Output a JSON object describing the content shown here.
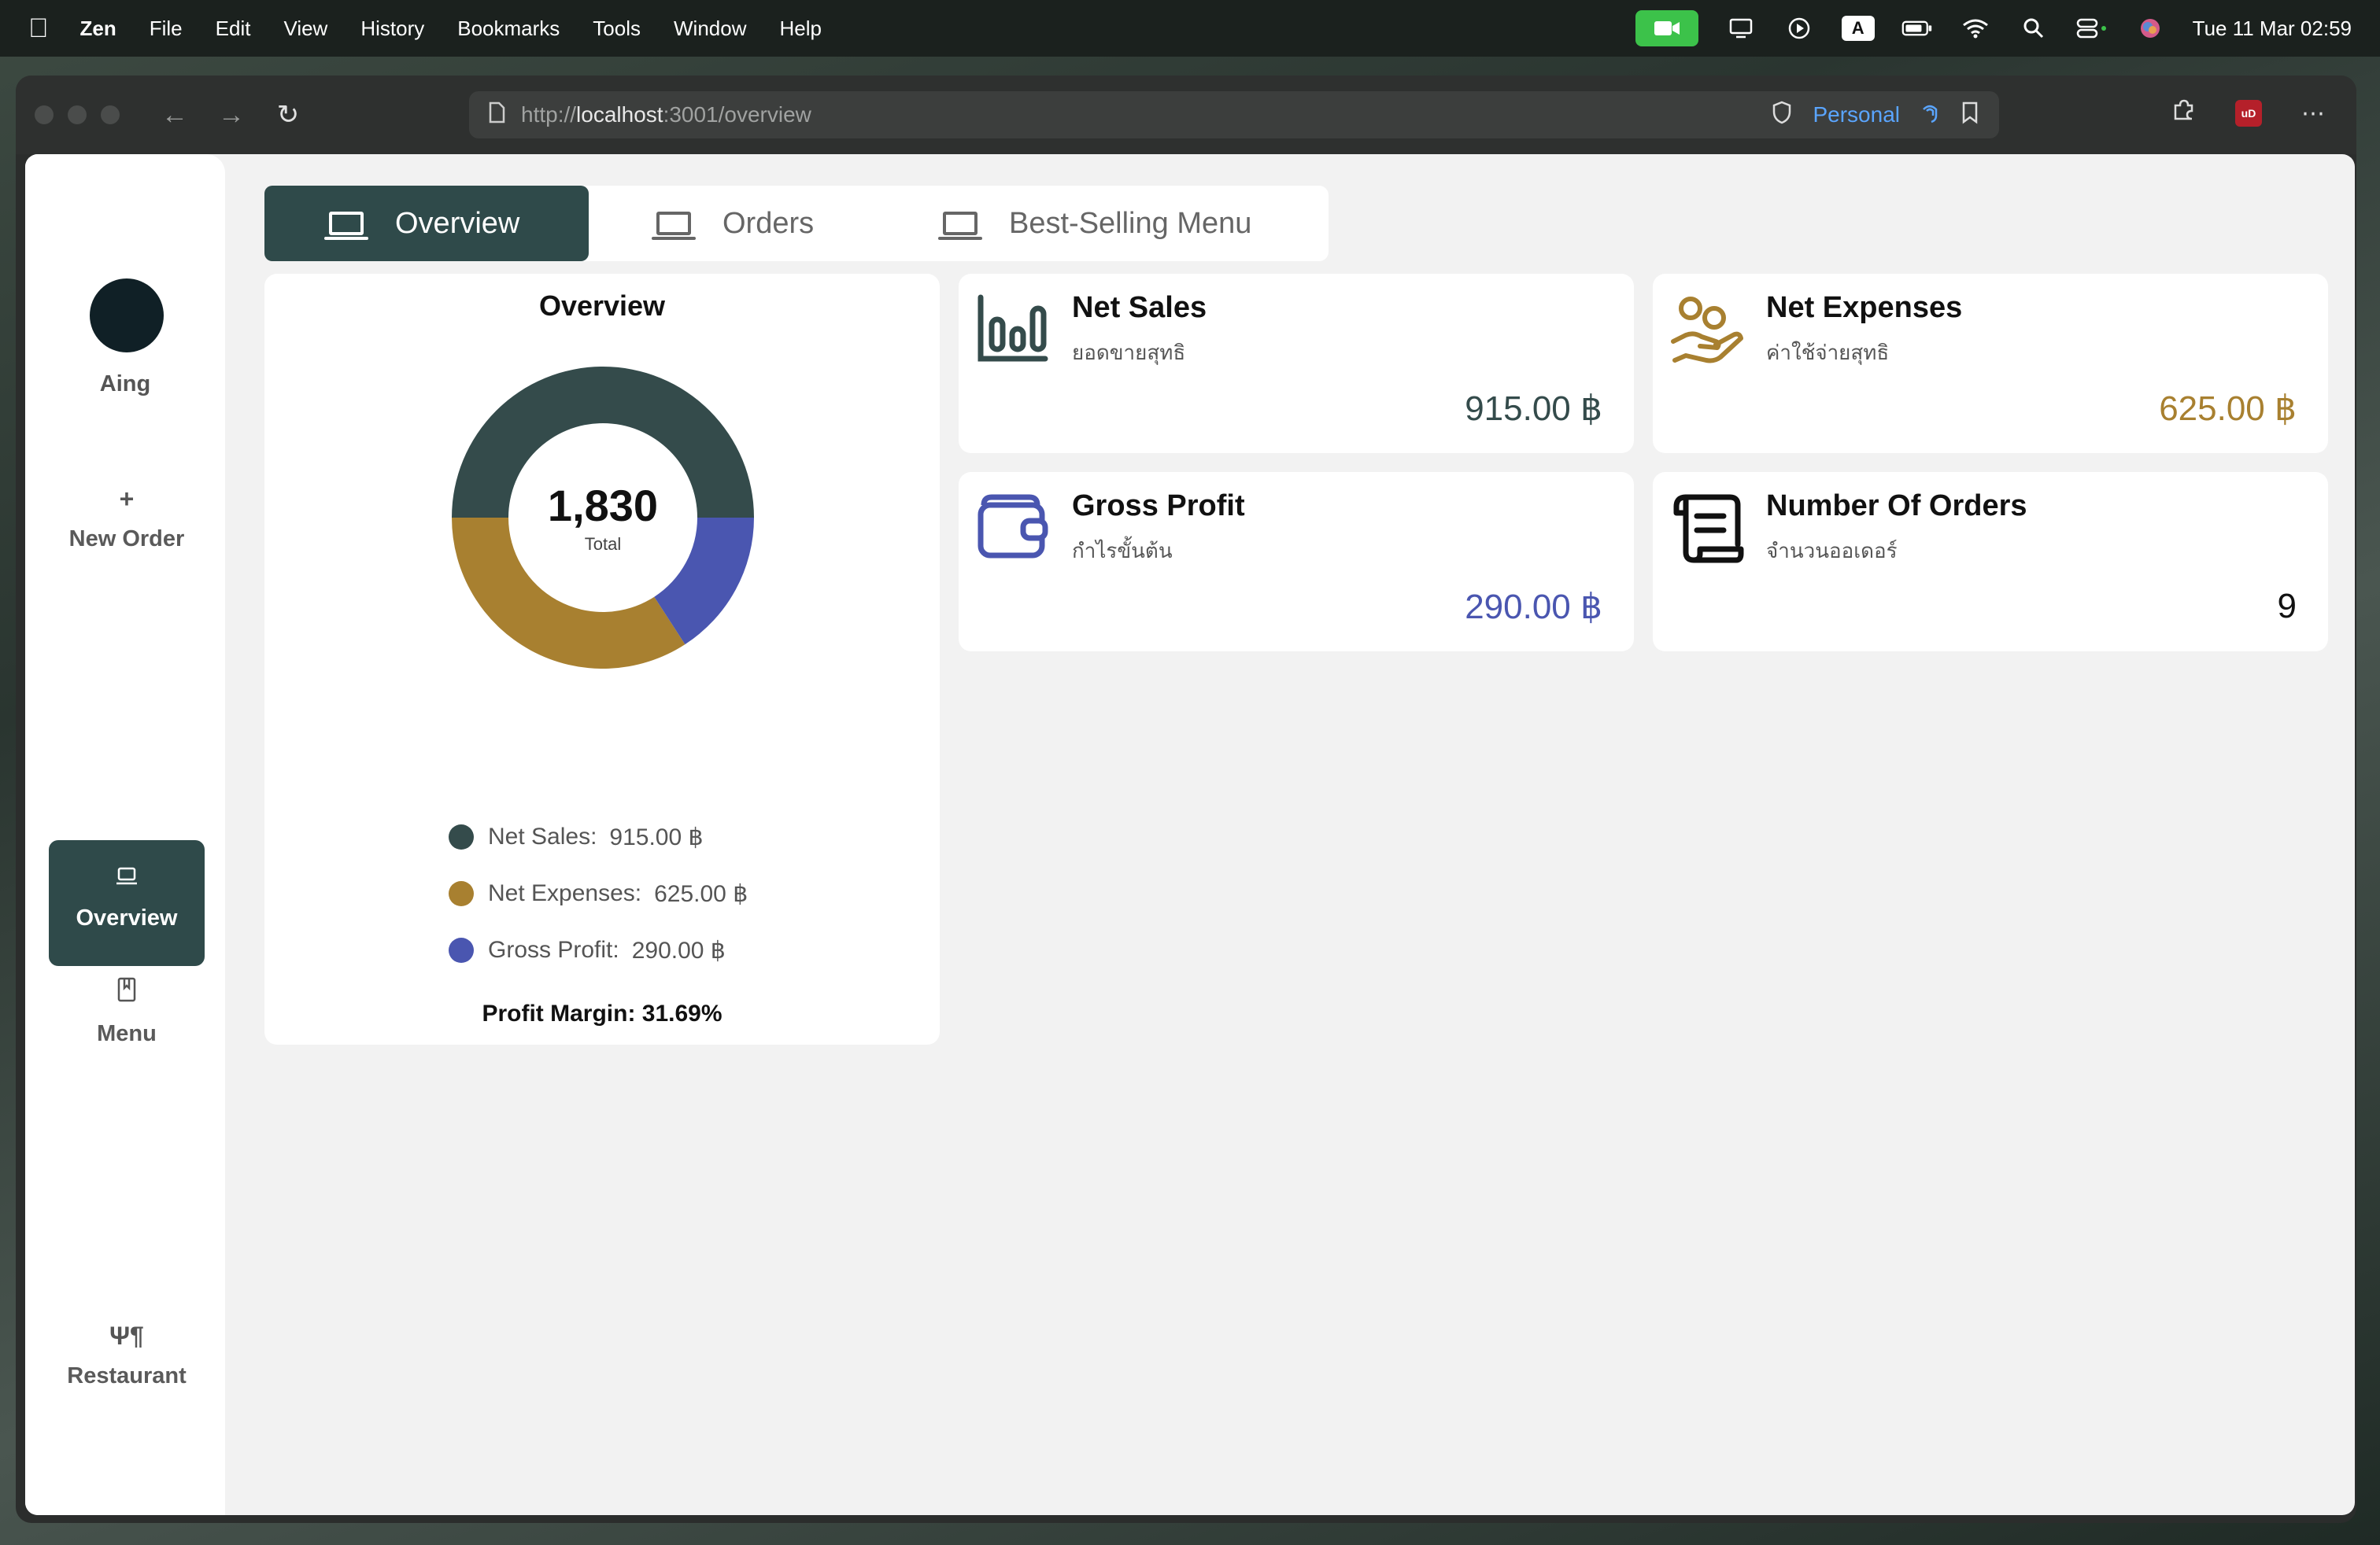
{
  "menubar": {
    "app_name": "Zen",
    "items": [
      "File",
      "Edit",
      "View",
      "History",
      "Bookmarks",
      "Tools",
      "Window",
      "Help"
    ],
    "clock": "Tue 11 Mar  02:59",
    "a_badge": "A"
  },
  "browser": {
    "url_prefix": "http://",
    "url_host": "localhost",
    "url_rest": ":3001/overview",
    "profile_label": "Personal",
    "ublock_label": "uD"
  },
  "sidebar": {
    "user_name": "Aing",
    "new_order": "New Order",
    "new_order_icon": "+",
    "overview": "Overview",
    "menu": "Menu",
    "restaurant": "Restaurant",
    "restaurant_icon": "Ψ¶"
  },
  "tabs": [
    {
      "label": "Overview",
      "active": true
    },
    {
      "label": "Orders",
      "active": false
    },
    {
      "label": "Best-Selling Menu",
      "active": false
    }
  ],
  "overview_card": {
    "title": "Overview",
    "total_value": "1,830",
    "total_label": "Total",
    "legend": [
      {
        "label": "Net Sales:",
        "value": "915.00 ฿",
        "color": "#344b4b"
      },
      {
        "label": "Net Expenses:",
        "value": "625.00 ฿",
        "color": "#a88030"
      },
      {
        "label": "Gross Profit:",
        "value": "290.00 ฿",
        "color": "#4a56b0"
      }
    ],
    "profit_margin": "Profit Margin: 31.69%"
  },
  "chart_data": {
    "type": "pie",
    "categories": [
      "Net Sales",
      "Net Expenses",
      "Gross Profit"
    ],
    "values": [
      915,
      625,
      290
    ],
    "colors": [
      "#344b4b",
      "#a88030",
      "#4a56b0"
    ],
    "title": "Overview"
  },
  "stats": {
    "net_sales": {
      "title": "Net Sales",
      "subtitle": "ยอดขายสุทธิ",
      "value": "915.00 ฿",
      "color": "#344b4b"
    },
    "net_expenses": {
      "title": "Net Expenses",
      "subtitle": "ค่าใช้จ่ายสุทธิ",
      "value": "625.00 ฿",
      "color": "#a88030"
    },
    "gross_profit": {
      "title": "Gross Profit",
      "subtitle": "กำไรขั้นต้น",
      "value": "290.00 ฿",
      "color": "#4a56b0"
    },
    "orders": {
      "title": "Number Of Orders",
      "subtitle": "จำนวนออเดอร์",
      "value": "9",
      "color": "#111111"
    }
  }
}
